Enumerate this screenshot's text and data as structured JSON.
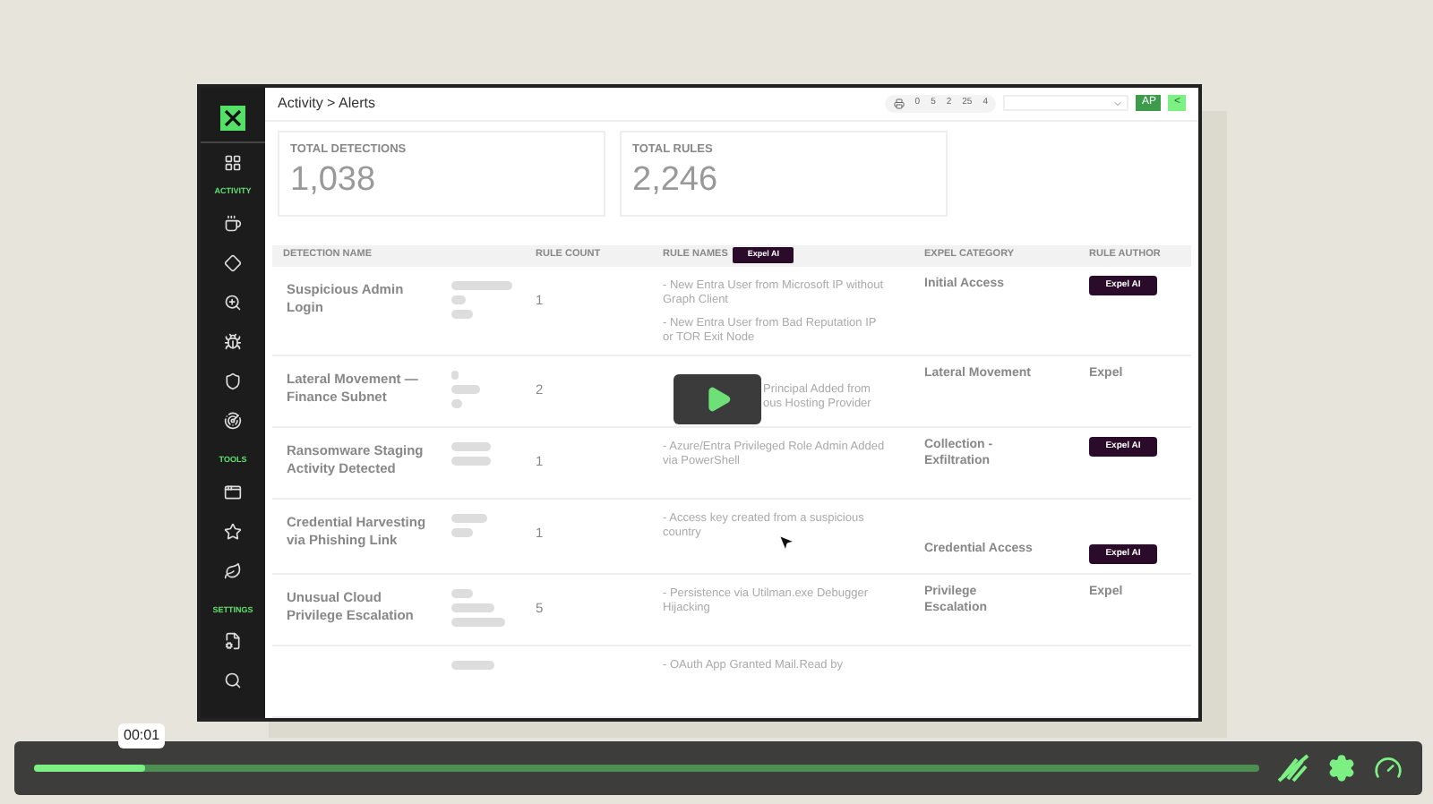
{
  "sidebar": {
    "sections": [
      {
        "label": "ACTIVITY",
        "items": [
          {
            "kind": "monitor"
          },
          {
            "kind": "alert-diamond"
          },
          {
            "kind": "zoom"
          },
          {
            "kind": "bug"
          },
          {
            "kind": "shield"
          },
          {
            "kind": "radar"
          }
        ]
      },
      {
        "label": "TOOLS",
        "items": [
          {
            "kind": "window"
          },
          {
            "kind": "star"
          },
          {
            "kind": "leaf"
          }
        ]
      },
      {
        "label": "SETTINGS",
        "items": [
          {
            "kind": "doc-gear"
          },
          {
            "kind": "search"
          }
        ]
      }
    ]
  },
  "breadcrumb": "Activity > Alerts",
  "counters": [
    "0",
    "5",
    "2",
    "25",
    "4"
  ],
  "user_button": "AP",
  "collapse_button": "<",
  "stats": [
    {
      "label": "TOTAL DETECTIONS",
      "value": "1,038"
    },
    {
      "label": "TOTAL RULES",
      "value": "2,246"
    }
  ],
  "table": {
    "columns": [
      "DETECTION NAME",
      "RULE COUNT",
      "RULE NAMES",
      "EXPEL CATEGORY",
      "RULE AUTHOR"
    ],
    "column_badge": "Expel AI",
    "rows": [
      {
        "name": "Suspicious Admin Login",
        "count": "1",
        "rules": [
          "- New Entra User from Microsoft IP without Graph Client",
          "- New Entra User from Bad Reputation IP or TOR Exit Node"
        ],
        "category": "Initial Access",
        "author": {
          "kind": "badge",
          "text": "Expel AI"
        }
      },
      {
        "name": "Lateral Movement — Finance Subnet",
        "count": "2",
        "rules": [
          "Principal Added from",
          "ous Hosting Provider"
        ],
        "category": "Lateral Movement",
        "author": {
          "kind": "text",
          "text": "Expel"
        }
      },
      {
        "name": "Ransomware Staging Activity Detected",
        "count": "1",
        "rules": [
          "- Azure/Entra Privileged Role Admin Added via PowerShell"
        ],
        "category": "Collection - Exfiltration",
        "author": {
          "kind": "badge",
          "text": "Expel AI"
        }
      },
      {
        "name": "Credential Harvesting via Phishing Link",
        "count": "1",
        "rules": [
          "- Access key created from a suspicious country"
        ],
        "category": "Credential Access",
        "author": {
          "kind": "badge",
          "text": "Expel AI"
        }
      },
      {
        "name": "Unusual Cloud Privilege Escalation",
        "count": "5",
        "rules": [
          "- Persistence via Utilman.exe Debugger Hijacking"
        ],
        "category": "Privilege Escalation",
        "author": {
          "kind": "text",
          "text": "Expel"
        }
      },
      {
        "rules": [
          "- OAuth App Granted Mail.Read by"
        ]
      }
    ]
  },
  "player": {
    "time": "00:01",
    "level": 0.09
  }
}
